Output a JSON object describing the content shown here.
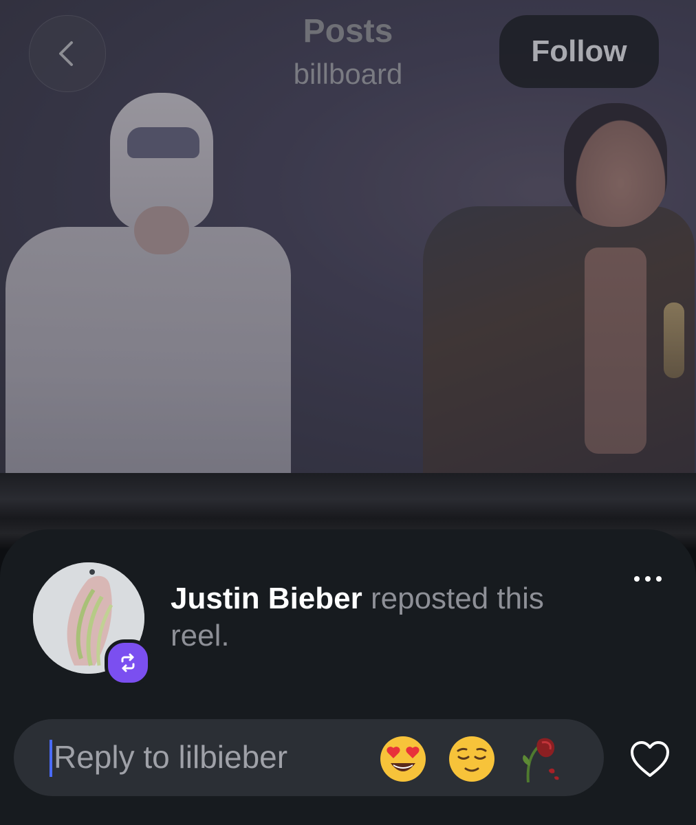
{
  "header": {
    "title": "Posts",
    "subtitle": "billboard",
    "follow_label": "Follow"
  },
  "repost": {
    "user_name": "Justin Bieber",
    "message": " reposted this reel."
  },
  "reply": {
    "placeholder": "Reply to lilbieber",
    "quick_reactions": [
      "heart-eyes-emoji",
      "relieved-face-emoji",
      "wilted-rose-emoji"
    ]
  },
  "colors": {
    "sheet_background": "#171b1f",
    "reply_bar": "#2b2f35",
    "repost_badge": "#7b4ff0",
    "caret": "#4a6bff"
  }
}
